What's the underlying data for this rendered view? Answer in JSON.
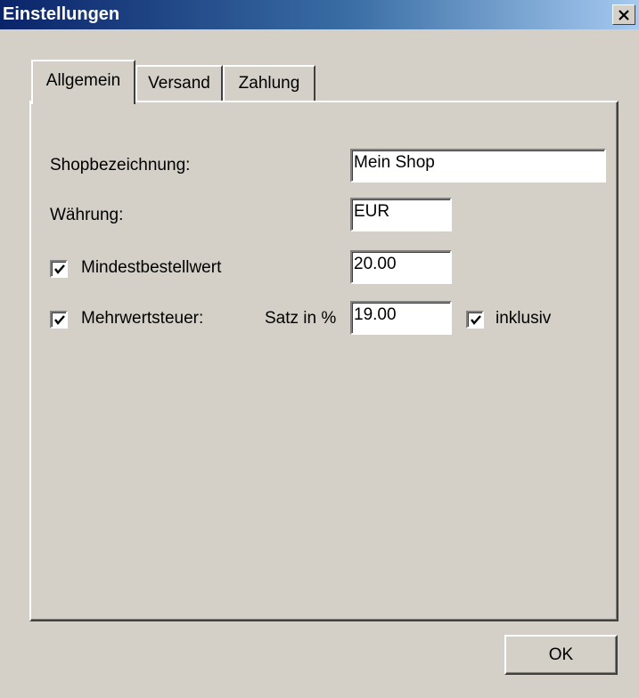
{
  "window": {
    "title": "Einstellungen",
    "close_icon": "close-icon"
  },
  "tabs": [
    {
      "label": "Allgemein",
      "active": true
    },
    {
      "label": "Versand",
      "active": false
    },
    {
      "label": "Zahlung",
      "active": false
    }
  ],
  "general": {
    "shop_name_label": "Shopbezeichnung:",
    "shop_name_value": "Mein Shop",
    "currency_label": "Währung:",
    "currency_value": "EUR",
    "min_order": {
      "label": "Mindestbestellwert",
      "checked": true,
      "value": "20.00"
    },
    "vat": {
      "label": "Mehrwertsteuer:",
      "checked": true,
      "rate_label": "Satz in %",
      "rate_value": "19.00",
      "inclusive_label": "inklusiv",
      "inclusive_checked": true
    }
  },
  "buttons": {
    "ok_label": "OK"
  },
  "colors": {
    "face": "#d4d0c8",
    "title_start": "#0a246a",
    "title_end": "#a6caf0"
  }
}
